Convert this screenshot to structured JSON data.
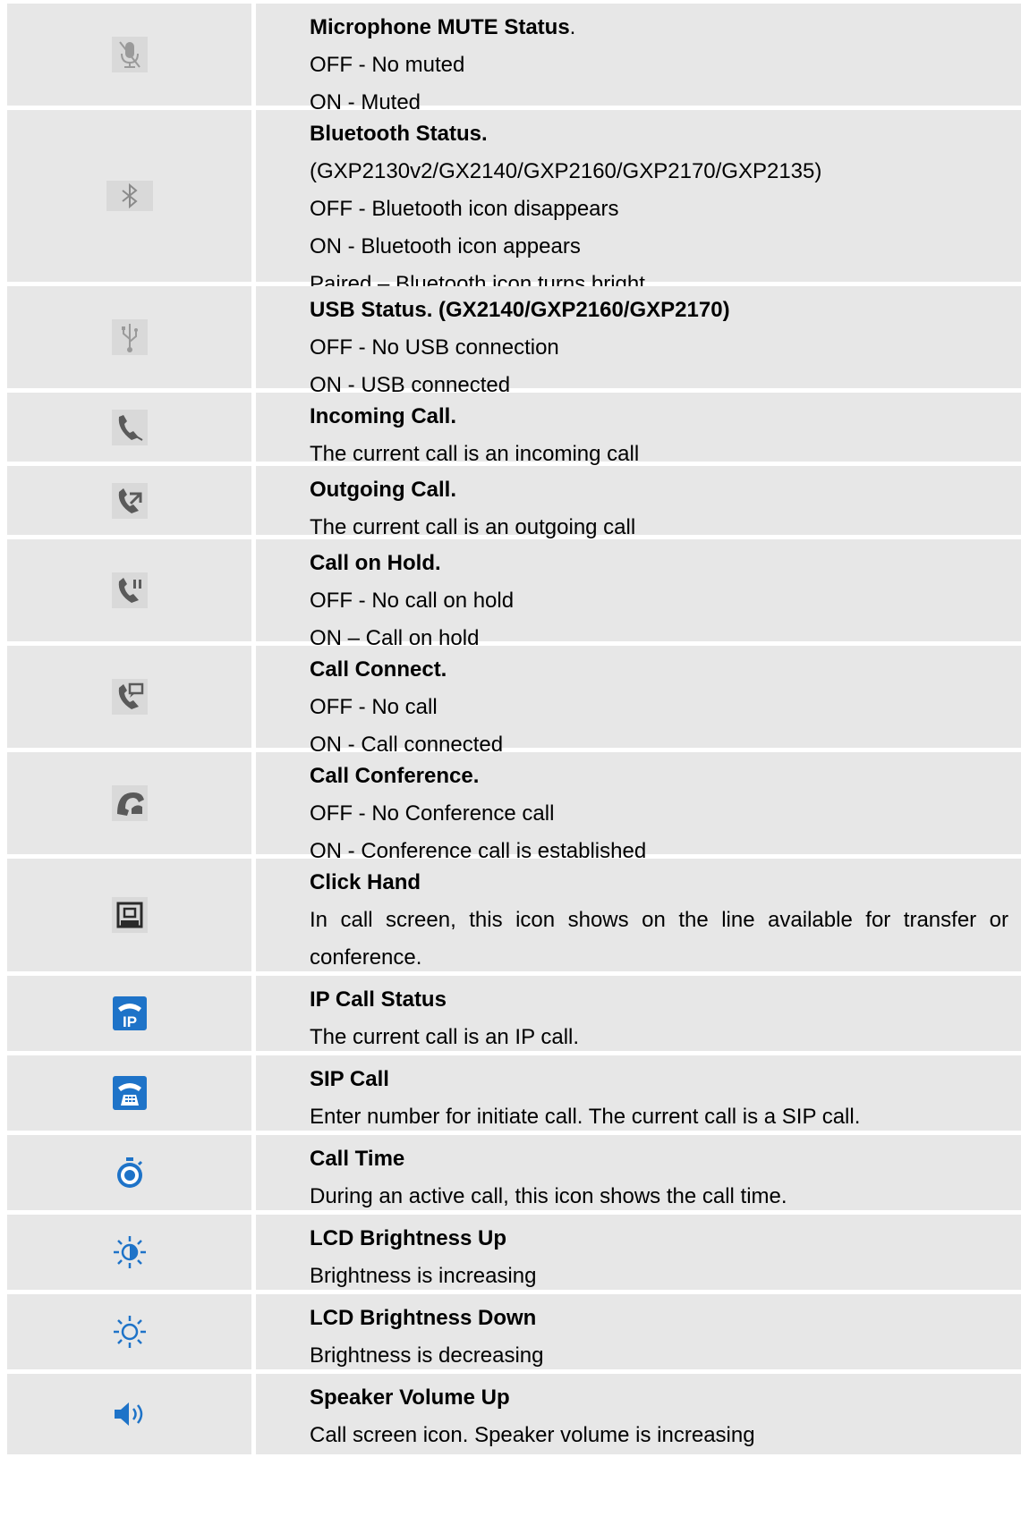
{
  "rows": [
    {
      "icon": "microphone-mute-icon",
      "title": "Microphone MUTE Status",
      "title_suffix": ".",
      "lines": [
        "OFF - No muted",
        "ON - Muted"
      ]
    },
    {
      "icon": "bluetooth-icon",
      "title": "Bluetooth Status.",
      "lines": [
        "(GXP2130v2/GX2140/GXP2160/GXP2170/GXP2135)",
        "OFF - Bluetooth icon disappears",
        "ON - Bluetooth icon appears",
        "Paired – Bluetooth icon turns bright"
      ]
    },
    {
      "icon": "usb-icon",
      "title": "USB Status. (GX2140/GXP2160/GXP2170)",
      "lines": [
        "OFF - No USB connection",
        "ON - USB connected"
      ]
    },
    {
      "icon": "incoming-call-icon",
      "title": "Incoming Call.",
      "lines": [
        "The current call is an incoming call"
      ]
    },
    {
      "icon": "outgoing-call-icon",
      "title": "Outgoing Call.",
      "lines": [
        "The current call is an outgoing call"
      ]
    },
    {
      "icon": "call-hold-icon",
      "title": "Call on Hold.",
      "lines": [
        "OFF - No call on hold",
        "ON – Call on hold"
      ]
    },
    {
      "icon": "call-connect-icon",
      "title": "Call Connect.",
      "lines": [
        "OFF - No call",
        "ON - Call connected"
      ]
    },
    {
      "icon": "call-conference-icon",
      "title": "Call Conference.",
      "lines": [
        "OFF - No Conference call",
        "ON - Conference call is established"
      ]
    },
    {
      "icon": "click-hand-icon",
      "title": "Click Hand",
      "paragraph": "In call screen, this icon shows on the line available for transfer or conference."
    },
    {
      "icon": "ip-call-icon",
      "title": "IP Call Status",
      "lines": [
        "The current call is an IP call."
      ]
    },
    {
      "icon": "sip-call-icon",
      "title": "SIP Call",
      "lines": [
        "Enter number for initiate call. The current call is a SIP call."
      ]
    },
    {
      "icon": "call-time-stopwatch-icon",
      "title": "Call Time",
      "lines": [
        "During an active call, this icon shows the call time."
      ]
    },
    {
      "icon": "brightness-up-icon",
      "title": "LCD Brightness Up",
      "lines": [
        "Brightness is increasing"
      ]
    },
    {
      "icon": "brightness-down-icon",
      "title": "LCD Brightness Down",
      "lines": [
        "Brightness is decreasing"
      ]
    },
    {
      "icon": "speaker-volume-up-icon",
      "title": "Speaker Volume Up",
      "lines": [
        "Call screen icon. Speaker volume is increasing"
      ]
    }
  ],
  "colors": {
    "cell_bg": "#e7e7e7",
    "gray_icon": "#8a8a8a",
    "blue_icon": "#1e73c8"
  }
}
